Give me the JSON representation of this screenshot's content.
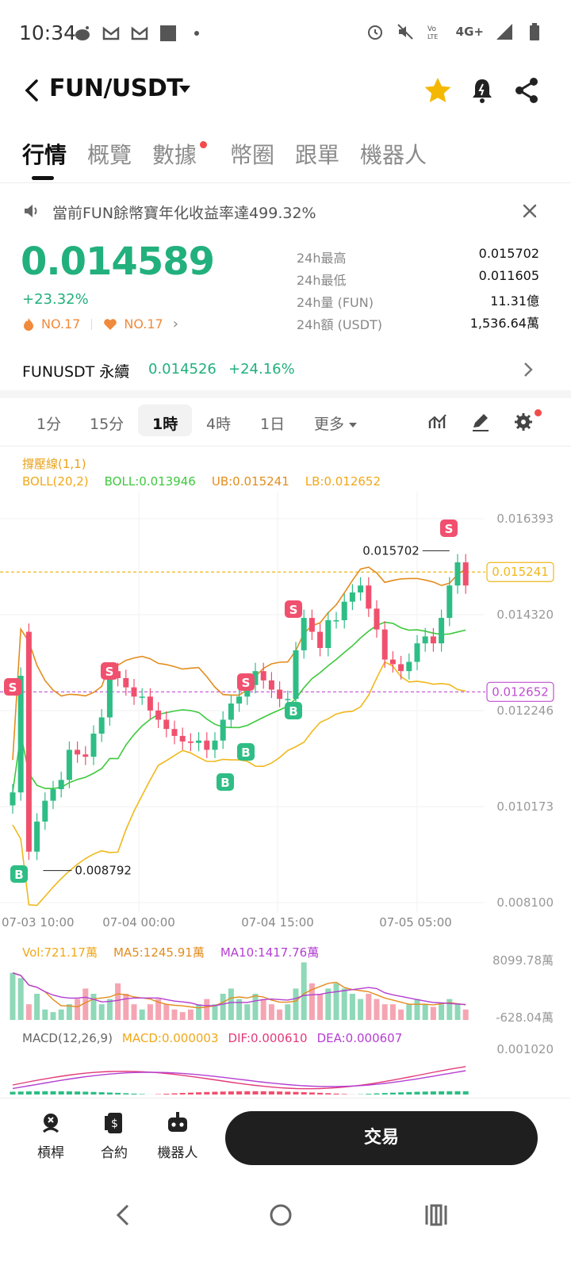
{
  "status_bar": {
    "time": "10:34",
    "network": "4G+"
  },
  "header": {
    "title": "FUN/USDT"
  },
  "tabs": [
    {
      "label": "行情",
      "active": true
    },
    {
      "label": "概覽"
    },
    {
      "label": "數據",
      "has_dot": true
    },
    {
      "label": "幣圈"
    },
    {
      "label": "跟單"
    },
    {
      "label": "機器人"
    }
  ],
  "notice": {
    "text": "當前FUN餘幣寶年化收益率達499.32%"
  },
  "ticker": {
    "price": "0.014589",
    "change": "+23.32%",
    "rank_hot": "NO.17",
    "rank_fav": "NO.17",
    "stats": [
      {
        "label": "24h最高",
        "value": "0.015702"
      },
      {
        "label": "24h最低",
        "value": "0.011605"
      },
      {
        "label": "24h量 (FUN)",
        "value": "11.31億"
      },
      {
        "label": "24h額 (USDT)",
        "value": "1,536.64萬"
      }
    ]
  },
  "perp": {
    "name": "FUNUSDT 永續",
    "price": "0.014526",
    "change": "+24.16%"
  },
  "timeframes": [
    {
      "label": "1分"
    },
    {
      "label": "15分"
    },
    {
      "label": "1時",
      "active": true
    },
    {
      "label": "4時"
    },
    {
      "label": "1日"
    },
    {
      "label": "更多"
    }
  ],
  "indicators": {
    "support": "撐壓線(1,1)",
    "boll_name": "BOLL(20,2)",
    "boll": "BOLL:0.013946",
    "ub": "UB:0.015241",
    "lb": "LB:0.012652",
    "vol": "Vol:721.17萬",
    "ma5": "MA5:1245.91萬",
    "ma10": "MA10:1417.76萬",
    "macd_name": "MACD(12,26,9)",
    "macd": "MACD:0.000003",
    "dif": "DIF:0.000610",
    "dea": "DEA:0.000607"
  },
  "chart_data": {
    "type": "candlestick",
    "y_axis_labels": [
      "0.016393",
      "0.014320",
      "0.012246",
      "0.010173",
      "0.008100"
    ],
    "ylim": [
      0.0081,
      0.016393
    ],
    "x_axis_labels": [
      "07-03 10:00",
      "07-04 00:00",
      "07-04 15:00",
      "07-05 05:00"
    ],
    "tagged_prices": {
      "ub": "0.015241",
      "lb": "0.012652"
    },
    "annotations": {
      "high": "0.015702",
      "low": "0.008792"
    },
    "volume_axis_labels": [
      "8099.78萬",
      "-628.04萬"
    ],
    "macd_axis_label": "0.001020",
    "colors": {
      "up": "#2ebd85",
      "down": "#f0506e",
      "boll_mid": "#3ec93e",
      "boll_upper": "#e38d1e",
      "boll_lower": "#f0b81a"
    }
  },
  "bottom_nav": {
    "items": [
      {
        "label": "槓桿"
      },
      {
        "label": "合約"
      },
      {
        "label": "機器人"
      }
    ],
    "trade_label": "交易"
  }
}
